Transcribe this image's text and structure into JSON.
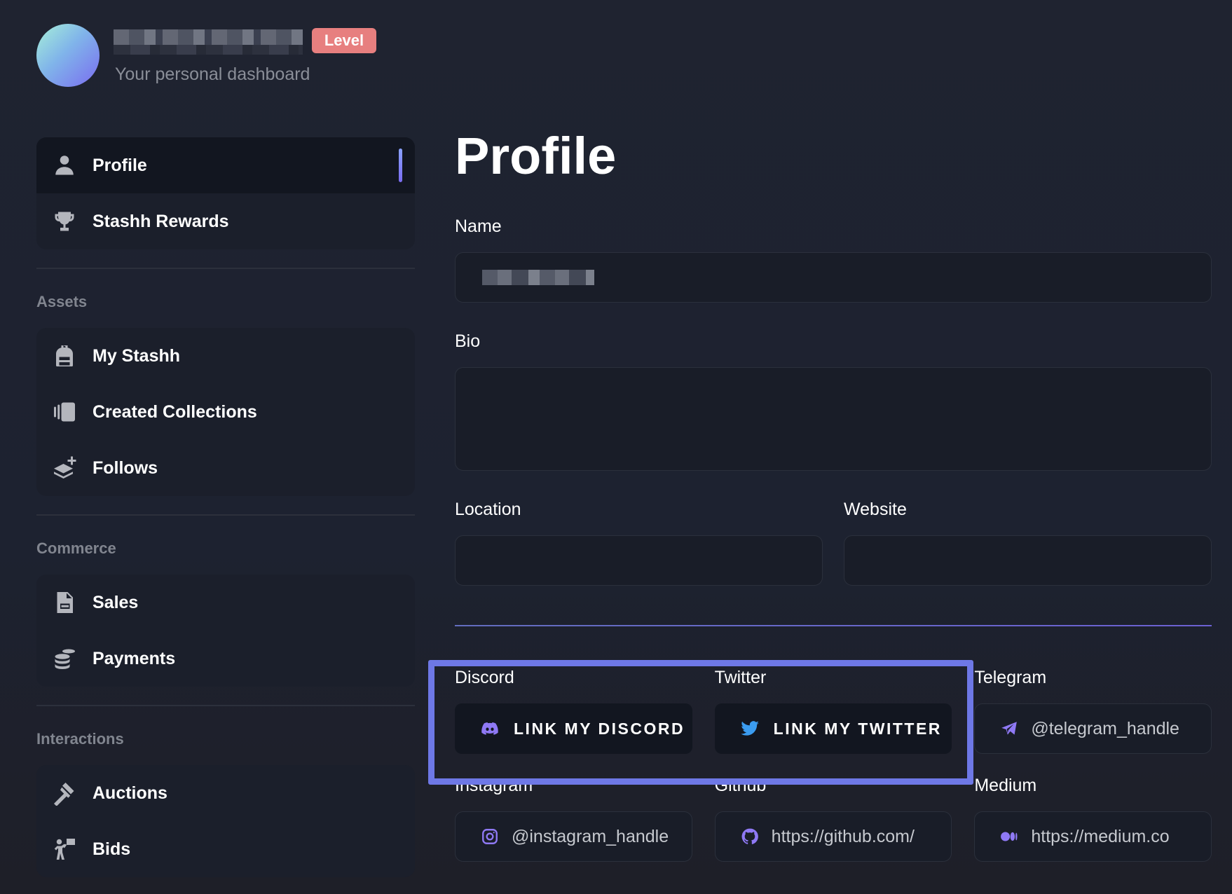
{
  "header": {
    "level_label": "Level",
    "subtitle": "Your personal dashboard"
  },
  "sidebar": {
    "top_items": [
      {
        "label": "Profile",
        "icon": "user-icon",
        "active": true
      },
      {
        "label": "Stashh Rewards",
        "icon": "trophy-icon"
      }
    ],
    "sections": [
      {
        "title": "Assets",
        "items": [
          {
            "label": "My Stashh",
            "icon": "backpack-icon"
          },
          {
            "label": "Created Collections",
            "icon": "collections-icon"
          },
          {
            "label": "Follows",
            "icon": "layers-plus-icon"
          }
        ]
      },
      {
        "title": "Commerce",
        "items": [
          {
            "label": "Sales",
            "icon": "receipt-icon"
          },
          {
            "label": "Payments",
            "icon": "coins-icon"
          }
        ]
      },
      {
        "title": "Interactions",
        "items": [
          {
            "label": "Auctions",
            "icon": "gavel-icon"
          },
          {
            "label": "Bids",
            "icon": "bid-sign-icon"
          }
        ]
      }
    ]
  },
  "main": {
    "title": "Profile",
    "fields": {
      "name_label": "Name",
      "bio_label": "Bio",
      "location_label": "Location",
      "website_label": "Website"
    },
    "socials": {
      "discord_label": "Discord",
      "discord_button": "LINK MY DISCORD",
      "twitter_label": "Twitter",
      "twitter_button": "LINK MY TWITTER",
      "telegram_label": "Telegram",
      "telegram_placeholder": "@telegram_handle",
      "instagram_label": "Instagram",
      "instagram_placeholder": "@instagram_handle",
      "github_label": "Github",
      "github_placeholder": "https://github.com/",
      "medium_label": "Medium",
      "medium_placeholder": "https://medium.co"
    }
  },
  "colors": {
    "accent": "#7a6cf0",
    "level_badge": "#e77f7f",
    "highlight": "#6e78e6",
    "twitter_blue": "#3b9cf0",
    "icon_purple": "#8f79f5"
  }
}
